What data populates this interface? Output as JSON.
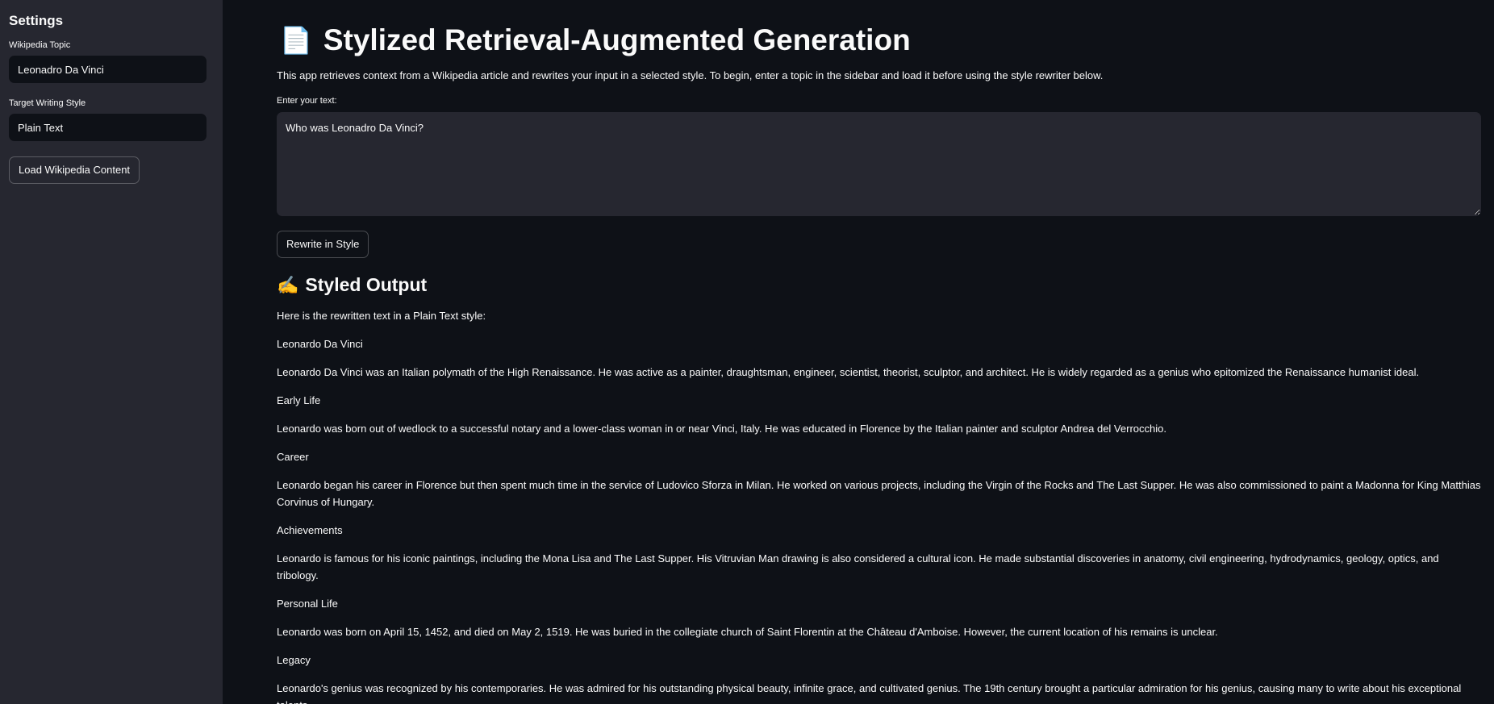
{
  "sidebar": {
    "title": "Settings",
    "topic_label": "Wikipedia Topic",
    "topic_value": "Leonadro Da Vinci",
    "style_label": "Target Writing Style",
    "style_value": "Plain Text",
    "load_button": "Load Wikipedia Content"
  },
  "main": {
    "title_emoji": "📄",
    "title": "Stylized Retrieval-Augmented Generation",
    "intro": "This app retrieves context from a Wikipedia article and rewrites your input in a selected style. To begin, enter a topic in the sidebar and load it before using the style rewriter below.",
    "input_label": "Enter your text:",
    "input_value": "Who was Leonadro Da Vinci?",
    "rewrite_button": "Rewrite in Style",
    "output_emoji": "✍️",
    "output_title": "Styled Output",
    "output_paragraphs": [
      "Here is the rewritten text in a Plain Text style:",
      "Leonardo Da Vinci",
      "Leonardo Da Vinci was an Italian polymath of the High Renaissance. He was active as a painter, draughtsman, engineer, scientist, theorist, sculptor, and architect. He is widely regarded as a genius who epitomized the Renaissance humanist ideal.",
      "Early Life",
      "Leonardo was born out of wedlock to a successful notary and a lower-class woman in or near Vinci, Italy. He was educated in Florence by the Italian painter and sculptor Andrea del Verrocchio.",
      "Career",
      "Leonardo began his career in Florence but then spent much time in the service of Ludovico Sforza in Milan. He worked on various projects, including the Virgin of the Rocks and The Last Supper. He was also commissioned to paint a Madonna for King Matthias Corvinus of Hungary.",
      "Achievements",
      "Leonardo is famous for his iconic paintings, including the Mona Lisa and The Last Supper. His Vitruvian Man drawing is also considered a cultural icon. He made substantial discoveries in anatomy, civil engineering, hydrodynamics, geology, optics, and tribology.",
      "Personal Life",
      "Leonardo was born on April 15, 1452, and died on May 2, 1519. He was buried in the collegiate church of Saint Florentin at the Château d'Amboise. However, the current location of his remains is unclear.",
      "Legacy",
      "Leonardo's genius was recognized by his contemporaries. He was admired for his outstanding physical beauty, infinite grace, and cultivated genius. The 19th century brought a particular admiration for his genius, causing many to write about his exceptional talents."
    ]
  },
  "colors": {
    "background": "#0e1117",
    "sidebar": "#262730",
    "text": "#fafafa"
  }
}
